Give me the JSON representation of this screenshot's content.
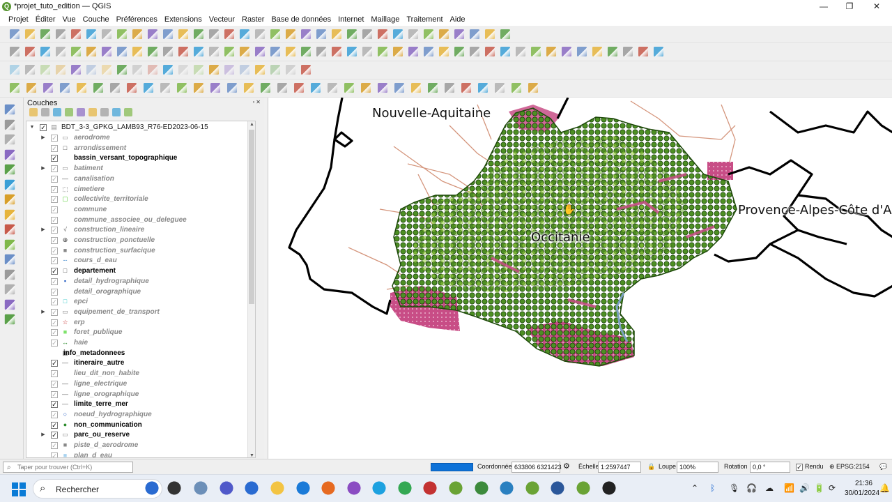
{
  "window": {
    "title": "*projet_tuto_edition — QGIS",
    "app_icon": "qgis-icon"
  },
  "menubar": [
    "Projet",
    "Éditer",
    "Vue",
    "Couche",
    "Préférences",
    "Extensions",
    "Vecteur",
    "Raster",
    "Base de données",
    "Internet",
    "Maillage",
    "Traitement",
    "Aide"
  ],
  "layers_panel": {
    "title": "Couches",
    "root": "BDT_3-3_GPKG_LAMB93_R76-ED2023-06-15",
    "layers": [
      {
        "name": "aerodrome",
        "checked": true,
        "active": false,
        "group": true,
        "symbol": "folder"
      },
      {
        "name": "arrondissement",
        "checked": true,
        "active": false,
        "group": false,
        "symbol": "polygon"
      },
      {
        "name": "bassin_versant_topographique",
        "checked": true,
        "active": true,
        "group": false,
        "symbol": "none"
      },
      {
        "name": "batiment",
        "checked": true,
        "active": false,
        "group": true,
        "symbol": "folder"
      },
      {
        "name": "canalisation",
        "checked": true,
        "active": false,
        "group": false,
        "symbol": "line"
      },
      {
        "name": "cimetiere",
        "checked": true,
        "active": false,
        "group": false,
        "symbol": "dashed-square"
      },
      {
        "name": "collectivite_territoriale",
        "checked": true,
        "active": false,
        "group": false,
        "symbol": "green-square"
      },
      {
        "name": "commune",
        "checked": true,
        "active": false,
        "group": false,
        "symbol": "none"
      },
      {
        "name": "commune_associee_ou_deleguee",
        "checked": true,
        "active": false,
        "group": false,
        "symbol": "none"
      },
      {
        "name": "construction_lineaire",
        "checked": true,
        "active": false,
        "group": true,
        "symbol": "folder-line"
      },
      {
        "name": "construction_ponctuelle",
        "checked": true,
        "active": false,
        "group": false,
        "symbol": "crosshair"
      },
      {
        "name": "construction_surfacique",
        "checked": true,
        "active": false,
        "group": false,
        "symbol": "grey-square"
      },
      {
        "name": "cours_d_eau",
        "checked": true,
        "active": false,
        "group": false,
        "symbol": "dashed-line"
      },
      {
        "name": "departement",
        "checked": true,
        "active": true,
        "group": false,
        "symbol": "polygon"
      },
      {
        "name": "detail_hydrographique",
        "checked": true,
        "active": false,
        "group": false,
        "symbol": "blue-dot"
      },
      {
        "name": "detail_orographique",
        "checked": true,
        "active": false,
        "group": false,
        "symbol": "none"
      },
      {
        "name": "epci",
        "checked": true,
        "active": false,
        "group": false,
        "symbol": "cyan-square"
      },
      {
        "name": "equipement_de_transport",
        "checked": true,
        "active": false,
        "group": true,
        "symbol": "folder"
      },
      {
        "name": "erp",
        "checked": true,
        "active": false,
        "group": false,
        "symbol": "red-star"
      },
      {
        "name": "foret_publique",
        "checked": true,
        "active": false,
        "group": false,
        "symbol": "lightgreen-square"
      },
      {
        "name": "haie",
        "checked": true,
        "active": false,
        "group": false,
        "symbol": "green-arrow"
      },
      {
        "name": "info_metadonnees",
        "checked": null,
        "active": true,
        "group": false,
        "symbol": "table"
      },
      {
        "name": "itineraire_autre",
        "checked": true,
        "active": true,
        "group": false,
        "symbol": "line"
      },
      {
        "name": "lieu_dit_non_habite",
        "checked": true,
        "active": false,
        "group": false,
        "symbol": "none"
      },
      {
        "name": "ligne_electrique",
        "checked": true,
        "active": false,
        "group": false,
        "symbol": "line"
      },
      {
        "name": "ligne_orographique",
        "checked": true,
        "active": false,
        "group": false,
        "symbol": "line"
      },
      {
        "name": "limite_terre_mer",
        "checked": true,
        "active": true,
        "group": false,
        "symbol": "line"
      },
      {
        "name": "noeud_hydrographique",
        "checked": true,
        "active": false,
        "group": false,
        "symbol": "blue-circle"
      },
      {
        "name": "non_communication",
        "checked": true,
        "active": true,
        "group": false,
        "symbol": "green-dot"
      },
      {
        "name": "parc_ou_reserve",
        "checked": true,
        "active": true,
        "group": true,
        "symbol": "folder"
      },
      {
        "name": "piste_d_aerodrome",
        "checked": true,
        "active": false,
        "group": false,
        "symbol": "grey-square"
      },
      {
        "name": "plan_d_eau",
        "checked": true,
        "active": false,
        "group": false,
        "symbol": "lightblue-square"
      }
    ]
  },
  "map": {
    "labels": {
      "nouvelle_aquitaine": "Nouvelle-Aquitaine",
      "occitanie": "Occitanie",
      "provence": "Provence-Alpes-Côte d'A"
    },
    "colors": {
      "fill": "#3f7f1e",
      "points": "#8ed13c",
      "pink": "#c84d86",
      "roads": "#d08a6e",
      "border": "#000000"
    }
  },
  "statusbar": {
    "locator_placeholder": "Taper pour trouver (Ctrl+K)",
    "coord_label": "Coordonnée",
    "coord_value": "633806 6321423",
    "scale_label": "Échelle",
    "scale_value": "1:2597447",
    "magnifier_label": "Loupe",
    "magnifier_value": "100%",
    "rotation_label": "Rotation",
    "rotation_value": "0,0 °",
    "render_label": "Rendu",
    "crs": "EPSG:2154"
  },
  "taskbar": {
    "search_placeholder": "Rechercher",
    "time": "21:36",
    "date": "30/01/2024"
  }
}
